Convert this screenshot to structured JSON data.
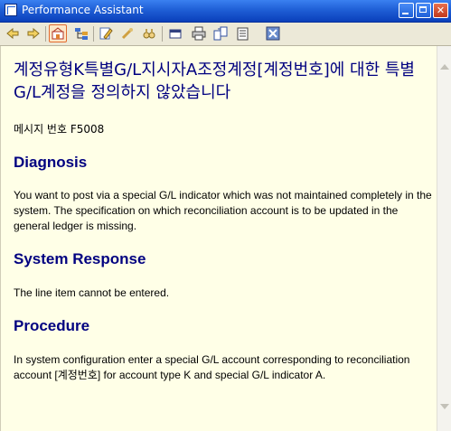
{
  "window": {
    "title": "Performance Assistant"
  },
  "toolbar": {
    "buttons": [
      {
        "name": "back",
        "icon": "arrow-left-icon"
      },
      {
        "name": "forward",
        "icon": "arrow-right-icon"
      },
      {
        "name": "technical-info",
        "icon": "document-structure-icon",
        "active": true
      },
      {
        "name": "navigation",
        "icon": "tree-icon"
      },
      {
        "name": "edit",
        "icon": "pencil-icon"
      },
      {
        "name": "link",
        "icon": "link-icon"
      },
      {
        "name": "search",
        "icon": "binoculars-icon"
      },
      {
        "name": "bookmark",
        "icon": "bookmark-icon"
      },
      {
        "name": "print",
        "icon": "printer-icon"
      },
      {
        "name": "export",
        "icon": "export-icon"
      },
      {
        "name": "notes",
        "icon": "notes-icon"
      },
      {
        "name": "close",
        "icon": "close-icon"
      }
    ]
  },
  "content": {
    "heading": "계정유형K특별G/L지시자A조정계정[계정번호]에 대한 특별G/L계정을 정의하지 않았습니다",
    "message_number": "메시지 번호 F5008",
    "sections": [
      {
        "title": "Diagnosis",
        "text": "You want to post via a special G/L indicator which was not maintained completely in the system. The specification on which reconciliation account is to be updated in the general ledger is missing."
      },
      {
        "title": "System Response",
        "text": "The line item cannot be entered."
      },
      {
        "title": "Procedure",
        "text": "In system configuration enter a special G/L account corresponding to reconciliation account [계정번호] for account type K and special G/L indicator A."
      }
    ]
  },
  "colors": {
    "titlebar": "#1f5fd6",
    "content_background": "#ffffe7",
    "heading": "#000080"
  }
}
